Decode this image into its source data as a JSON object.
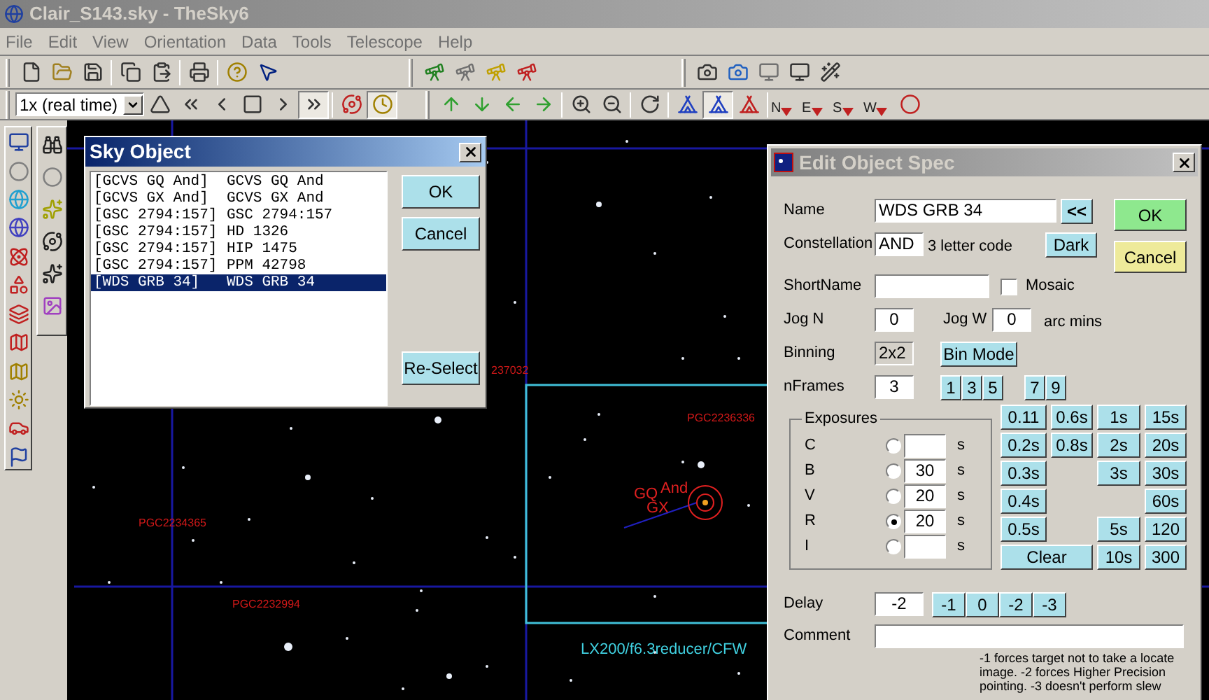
{
  "window": {
    "title": "Clair_S143.sky - TheSky6"
  },
  "menu": [
    "File",
    "Edit",
    "View",
    "Orientation",
    "Data",
    "Tools",
    "Telescope",
    "Help"
  ],
  "time_step": {
    "value": "1x (real time)"
  },
  "compass_buttons": [
    "N",
    "E",
    "S",
    "W"
  ],
  "sky_map": {
    "labels": [
      {
        "text": "237032",
        "kind": "object"
      },
      {
        "text": "PGC2236336",
        "kind": "object"
      },
      {
        "text": "GQ",
        "kind": "star"
      },
      {
        "text": "And",
        "kind": "star"
      },
      {
        "text": "GX",
        "kind": "star"
      },
      {
        "text": "PGC2234365",
        "kind": "object"
      },
      {
        "text": "PGC2232994",
        "kind": "object"
      },
      {
        "text": "LX200/f6.3reducer/CFW",
        "kind": "field"
      }
    ]
  },
  "sky_object_dialog": {
    "title": "Sky Object",
    "items": [
      {
        "catalog": "[GCVS GQ And]",
        "name": "GCVS GQ And",
        "selected": false
      },
      {
        "catalog": "[GCVS GX And]",
        "name": "GCVS GX And",
        "selected": false
      },
      {
        "catalog": "[GSC 2794:157]",
        "name": "GSC 2794:157",
        "selected": false
      },
      {
        "catalog": "[GSC 2794:157]",
        "name": "HD 1326",
        "selected": false
      },
      {
        "catalog": "[GSC 2794:157]",
        "name": "HIP 1475",
        "selected": false
      },
      {
        "catalog": "[GSC 2794:157]",
        "name": "PPM 42798",
        "selected": false
      },
      {
        "catalog": "[WDS GRB 34]",
        "name": "WDS GRB 34",
        "selected": true
      }
    ],
    "buttons": [
      "OK",
      "Cancel",
      "Re-Select"
    ]
  },
  "edit_dialog": {
    "title": "Edit Object Spec",
    "name": {
      "label": "Name",
      "value": "WDS GRB 34",
      "button": "<<"
    },
    "ok": "OK",
    "cancel": "Cancel",
    "constellation": {
      "label": "Constellation",
      "value": "AND",
      "hint": "3 letter code",
      "button": "Dark"
    },
    "short_name": {
      "label": "ShortName"
    },
    "mosaic": {
      "label": "Mosaic",
      "checked": false
    },
    "jog_n": {
      "label": "Jog N",
      "value": "0"
    },
    "jog_w": {
      "label": "Jog W",
      "value": "0",
      "unit": "arc mins"
    },
    "binning": {
      "label": "Binning",
      "value": "2x2",
      "button": "Bin Mode"
    },
    "frames": {
      "label": "nFrames",
      "value": "3",
      "buttons": [
        "1",
        "3",
        "5",
        "7",
        "9"
      ]
    },
    "exposures": {
      "title": "Exposures",
      "filters": [
        {
          "filter": "C",
          "selected": false,
          "unit": "s"
        },
        {
          "filter": "B",
          "value": "30",
          "selected": false,
          "unit": "s"
        },
        {
          "filter": "V",
          "value": "20",
          "selected": false,
          "unit": "s"
        },
        {
          "filter": "R",
          "value": "20",
          "selected": true,
          "unit": "s"
        },
        {
          "filter": "I",
          "selected": false,
          "unit": "s"
        }
      ]
    },
    "time_button_columns": [
      [
        {
          "label": "0.11",
          "kind": "time"
        },
        {
          "label": "0.2s",
          "kind": "time"
        },
        {
          "label": "0.3s",
          "kind": "time"
        },
        {
          "label": "0.4s",
          "kind": "time"
        },
        {
          "label": "0.5s",
          "kind": "time"
        },
        {
          "label": "Clear",
          "kind": "wide"
        }
      ],
      [
        {
          "label": "0.6s",
          "kind": "time"
        },
        {
          "label": "0.8s",
          "kind": "time"
        }
      ],
      [
        {
          "label": "1s",
          "kind": "time"
        },
        {
          "label": "2s",
          "kind": "time"
        },
        {
          "label": "3s",
          "kind": "time"
        },
        {
          "label": "5s",
          "kind": "time"
        },
        {
          "label": "10s",
          "kind": "time"
        }
      ],
      [
        {
          "label": "15s",
          "kind": "time"
        },
        {
          "label": "20s",
          "kind": "time"
        },
        {
          "label": "30s",
          "kind": "time"
        },
        {
          "label": "60s",
          "kind": "time"
        },
        {
          "label": "120",
          "kind": "time"
        },
        {
          "label": "300",
          "kind": "time"
        }
      ]
    ],
    "delay": {
      "label": "Delay",
      "value": "-2",
      "buttons": [
        "-1",
        "0",
        "-2",
        "-3"
      ]
    },
    "comment": {
      "label": "Comment"
    },
    "note": "-1 forces target not to take a locate image.  -2 forces Higher Precision pointing. -3 doesn't perform slew"
  }
}
